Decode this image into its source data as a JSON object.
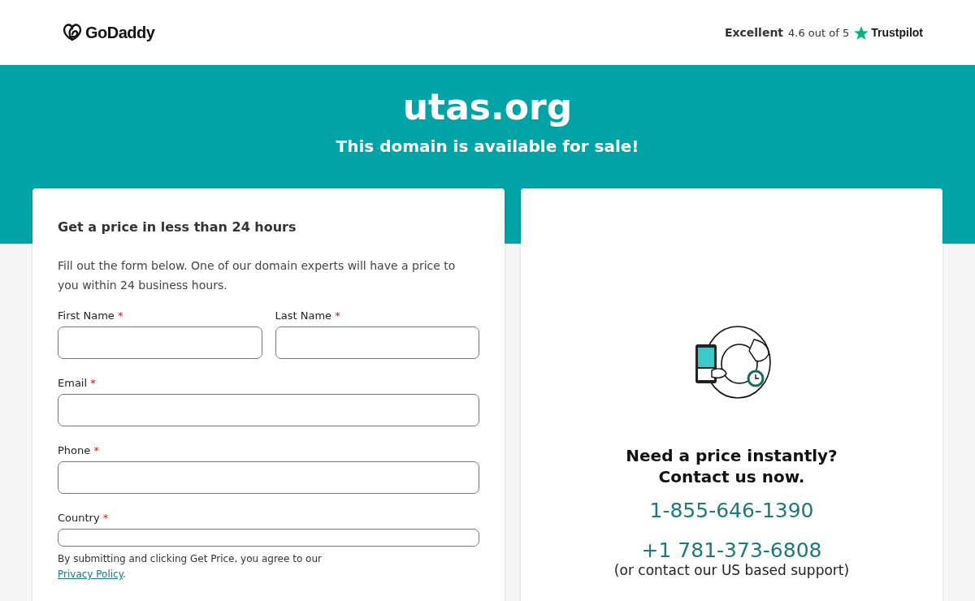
{
  "header": {
    "logo": "GoDaddy",
    "rating": {
      "label": "Excellent",
      "score": "4.6 out of 5",
      "brand": "Trustpilot"
    }
  },
  "hero": {
    "domain": "utas.org",
    "tagline": "This domain is available for sale!"
  },
  "form": {
    "title": "Get a price in less than 24 hours",
    "intro": "Fill out the form below. One of our domain experts will have a price to you within 24 business hours.",
    "fields": [
      {
        "label": "First Name",
        "marker": "*",
        "kind": "half"
      },
      {
        "label": "Last Name",
        "marker": "*",
        "kind": "half"
      },
      {
        "label": "Email",
        "marker": "*",
        "kind": "full"
      },
      {
        "label": "Phone",
        "marker": "*",
        "kind": "full"
      },
      {
        "label": "Country",
        "marker": "*",
        "kind": "select"
      }
    ],
    "consent": {
      "text": "By submitting and clicking Get Price, you agree to our",
      "link": "Privacy Policy",
      "end": "."
    }
  },
  "contact": {
    "heading_1": "Need a price instantly?",
    "heading_2": "Contact us now.",
    "phones": [
      "1-855-646-1390",
      "+1 781-373-6808"
    ],
    "note": "(or contact our US based support)"
  }
}
